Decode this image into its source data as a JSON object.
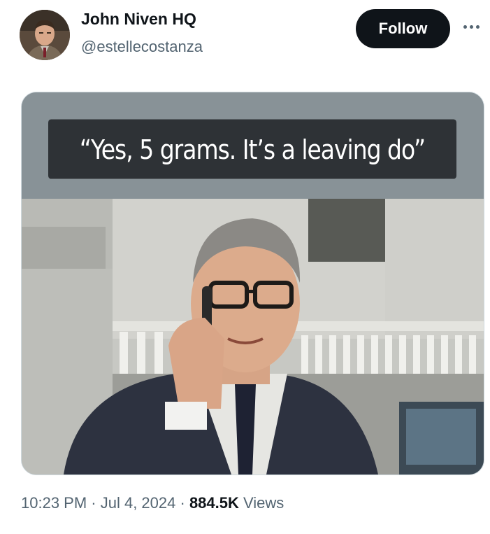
{
  "author": {
    "display_name": "John Niven HQ",
    "handle": "@estellecostanza",
    "avatar_icon": "user-avatar"
  },
  "actions": {
    "follow_label": "Follow",
    "more_icon": "more-horizontal-icon"
  },
  "media": {
    "caption": "“Yes, 5 grams. It’s a leaving do”"
  },
  "meta": {
    "time": "10:23 PM",
    "sep1": " · ",
    "date": "Jul 4, 2024",
    "sep2": " · ",
    "views_count": "884.5K",
    "views_label": " Views"
  },
  "colors": {
    "primary_text": "#0f1419",
    "secondary_text": "#536471",
    "follow_bg": "#0f1419"
  }
}
